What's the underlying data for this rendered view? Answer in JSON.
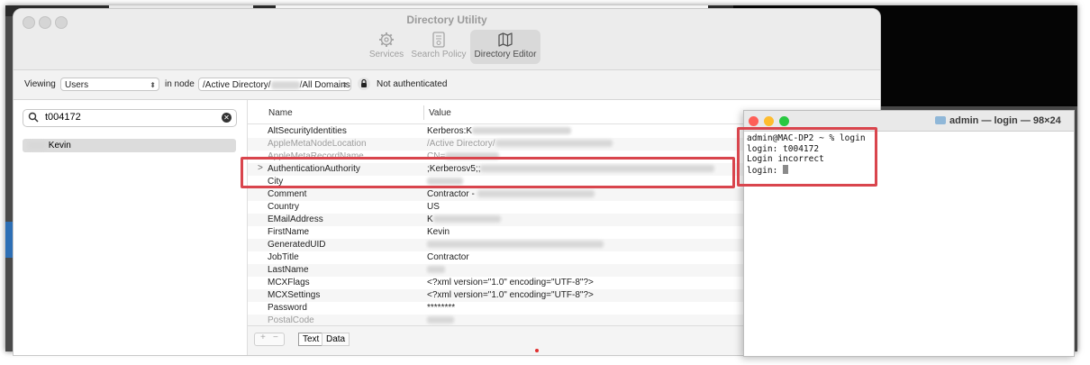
{
  "directory_utility": {
    "title": "Directory Utility",
    "toolbar": [
      {
        "label": "Services",
        "icon": "gear-icon"
      },
      {
        "label": "Search Policy",
        "icon": "document-icon"
      },
      {
        "label": "Directory Editor",
        "icon": "map-icon",
        "active": true
      }
    ],
    "viewbar": {
      "viewing_label": "Viewing",
      "viewing_value": "Users",
      "in_node_label": "in node",
      "node_value_prefix": "/Active Directory/",
      "node_value_suffix": "/All Domains",
      "auth_status": "Not authenticated"
    },
    "search": {
      "value": "t004172"
    },
    "user_list": [
      {
        "name": "Kevin"
      }
    ],
    "table": {
      "headers": {
        "name": "Name",
        "value": "Value"
      },
      "rows": [
        {
          "name": "AltSecurityIdentities",
          "value": "Kerberos:K",
          "faded": false
        },
        {
          "name": "AppleMetaNodeLocation",
          "value": "/Active Directory/",
          "faded": true
        },
        {
          "name": "AppleMetaRecordName",
          "value": "CN=",
          "faded": true
        },
        {
          "name": "AuthenticationAuthority",
          "value": ";Kerberosv5;;",
          "faded": false,
          "expandable": true
        },
        {
          "name": "City",
          "value": "",
          "faded": false
        },
        {
          "name": "Comment",
          "value": "Contractor -",
          "faded": false
        },
        {
          "name": "Country",
          "value": "US",
          "faded": false
        },
        {
          "name": "EMailAddress",
          "value": "K",
          "faded": false
        },
        {
          "name": "FirstName",
          "value": "Kevin",
          "faded": false
        },
        {
          "name": "GeneratedUID",
          "value": "",
          "faded": false
        },
        {
          "name": "JobTitle",
          "value": "Contractor",
          "faded": false
        },
        {
          "name": "LastName",
          "value": "",
          "faded": false
        },
        {
          "name": "MCXFlags",
          "value": "<?xml version=\"1.0\" encoding=\"UTF-8\"?>",
          "faded": false
        },
        {
          "name": "MCXSettings",
          "value": "<?xml version=\"1.0\" encoding=\"UTF-8\"?>",
          "faded": false
        },
        {
          "name": "Password",
          "value": "********",
          "faded": false
        },
        {
          "name": "PostalCode",
          "value": "",
          "faded": false
        }
      ]
    },
    "bottom": {
      "plus": "+",
      "minus": "−",
      "text_tab": "Text",
      "data_tab": "Data"
    }
  },
  "terminal": {
    "title": "admin — login — 98×24",
    "lines": [
      "admin@MAC-DP2 ~ % login",
      "login: t004172",
      "Login incorrect",
      "login: "
    ]
  },
  "colors": {
    "highlight": "#d9454d",
    "close": "#fe5f57",
    "minimize": "#febc2e",
    "zoom": "#28c840"
  }
}
